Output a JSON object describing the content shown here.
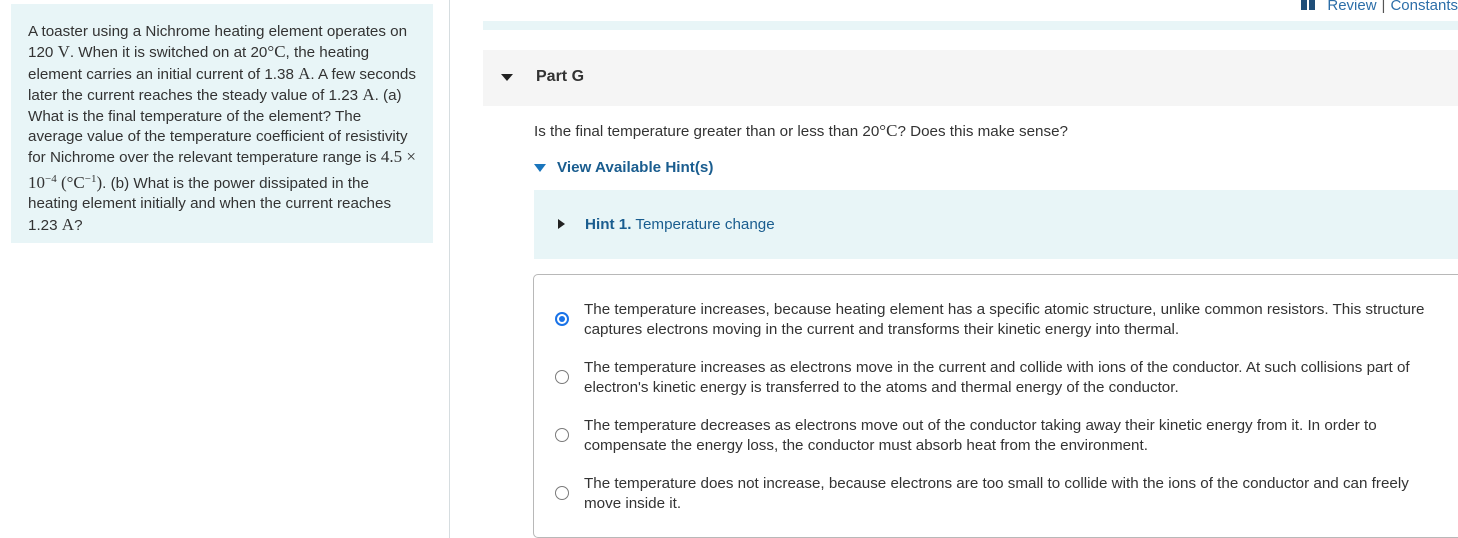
{
  "problem": {
    "parts": [
      "A toaster using a Nichrome heating element operates on 120 ",
      "V",
      ". When it is switched on at 20",
      "°C",
      ", the heating element carries an initial current of 1.38 ",
      "A",
      ". A few seconds later the current reaches the steady value of 1.23 ",
      "A",
      ". (a) What is the final temperature of the element? The average value of the temperature coefficient of resistivity for Nichrome over the relevant temperature range is ",
      "4.5 × 10",
      "−4",
      " (°C",
      "−1",
      ")",
      ". (b) What is the power dissipated in the heating element initially and when the current reaches 1.23 ",
      "A",
      "?"
    ]
  },
  "header_links": {
    "review": "Review",
    "separator": "|",
    "constants": "Constants"
  },
  "part": {
    "title": "Part G"
  },
  "question": {
    "pre": "Is the final temperature greater than or less than 20",
    "unit": "°C",
    "post": "? Does this make sense?"
  },
  "hints": {
    "toggle_label": "View Available Hint(s)",
    "items": [
      {
        "number": "Hint 1.",
        "title": "Temperature change"
      }
    ]
  },
  "options": [
    {
      "text": "The temperature increases, because heating element has a specific atomic structure, unlike common resistors. This structure captures electrons moving in the current and transforms their kinetic energy into thermal.",
      "selected": true
    },
    {
      "text": "The temperature increases as electrons move in the current and collide with ions of the conductor. At such collisions part of electron's kinetic energy is transferred to the atoms and thermal energy of the conductor.",
      "selected": false
    },
    {
      "text": "The temperature decreases as electrons move out of the conductor taking away their kinetic energy from it. In order to compensate the energy loss, the conductor must absorb heat from the environment.",
      "selected": false
    },
    {
      "text": "The temperature does not increase, because electrons are too small to collide with the ions of the conductor and can freely move inside it.",
      "selected": false
    }
  ],
  "colors": {
    "panel_bg": "#e8f5f7",
    "link": "#1a5d8f",
    "radio_selected": "#1a73e8"
  }
}
